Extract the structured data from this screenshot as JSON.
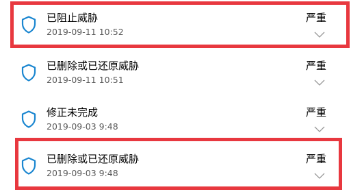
{
  "threats": [
    {
      "name": "已阻止威胁",
      "date": "2019-09-11 10:52",
      "severity": "严重",
      "icon": "shield-icon",
      "expand_icon": "chevron-down-icon"
    },
    {
      "name": "已删除或已还原威胁",
      "date": "2019-09-11 10:51",
      "severity": "严重",
      "icon": "shield-icon",
      "expand_icon": "chevron-down-icon"
    },
    {
      "name": "修正未完成",
      "date": "2019-09-03 9:48",
      "severity": "严重",
      "icon": "shield-icon",
      "expand_icon": "chevron-down-icon"
    },
    {
      "name": "已删除或已还原威胁",
      "date": "2019-09-03 9:48",
      "severity": "严重",
      "icon": "shield-icon",
      "expand_icon": "chevron-down-icon"
    }
  ],
  "colors": {
    "shield_stroke": "#1a86d0",
    "highlight_border": "#e8383f",
    "chevron": "#999999",
    "date_text": "#5a5a5a"
  }
}
